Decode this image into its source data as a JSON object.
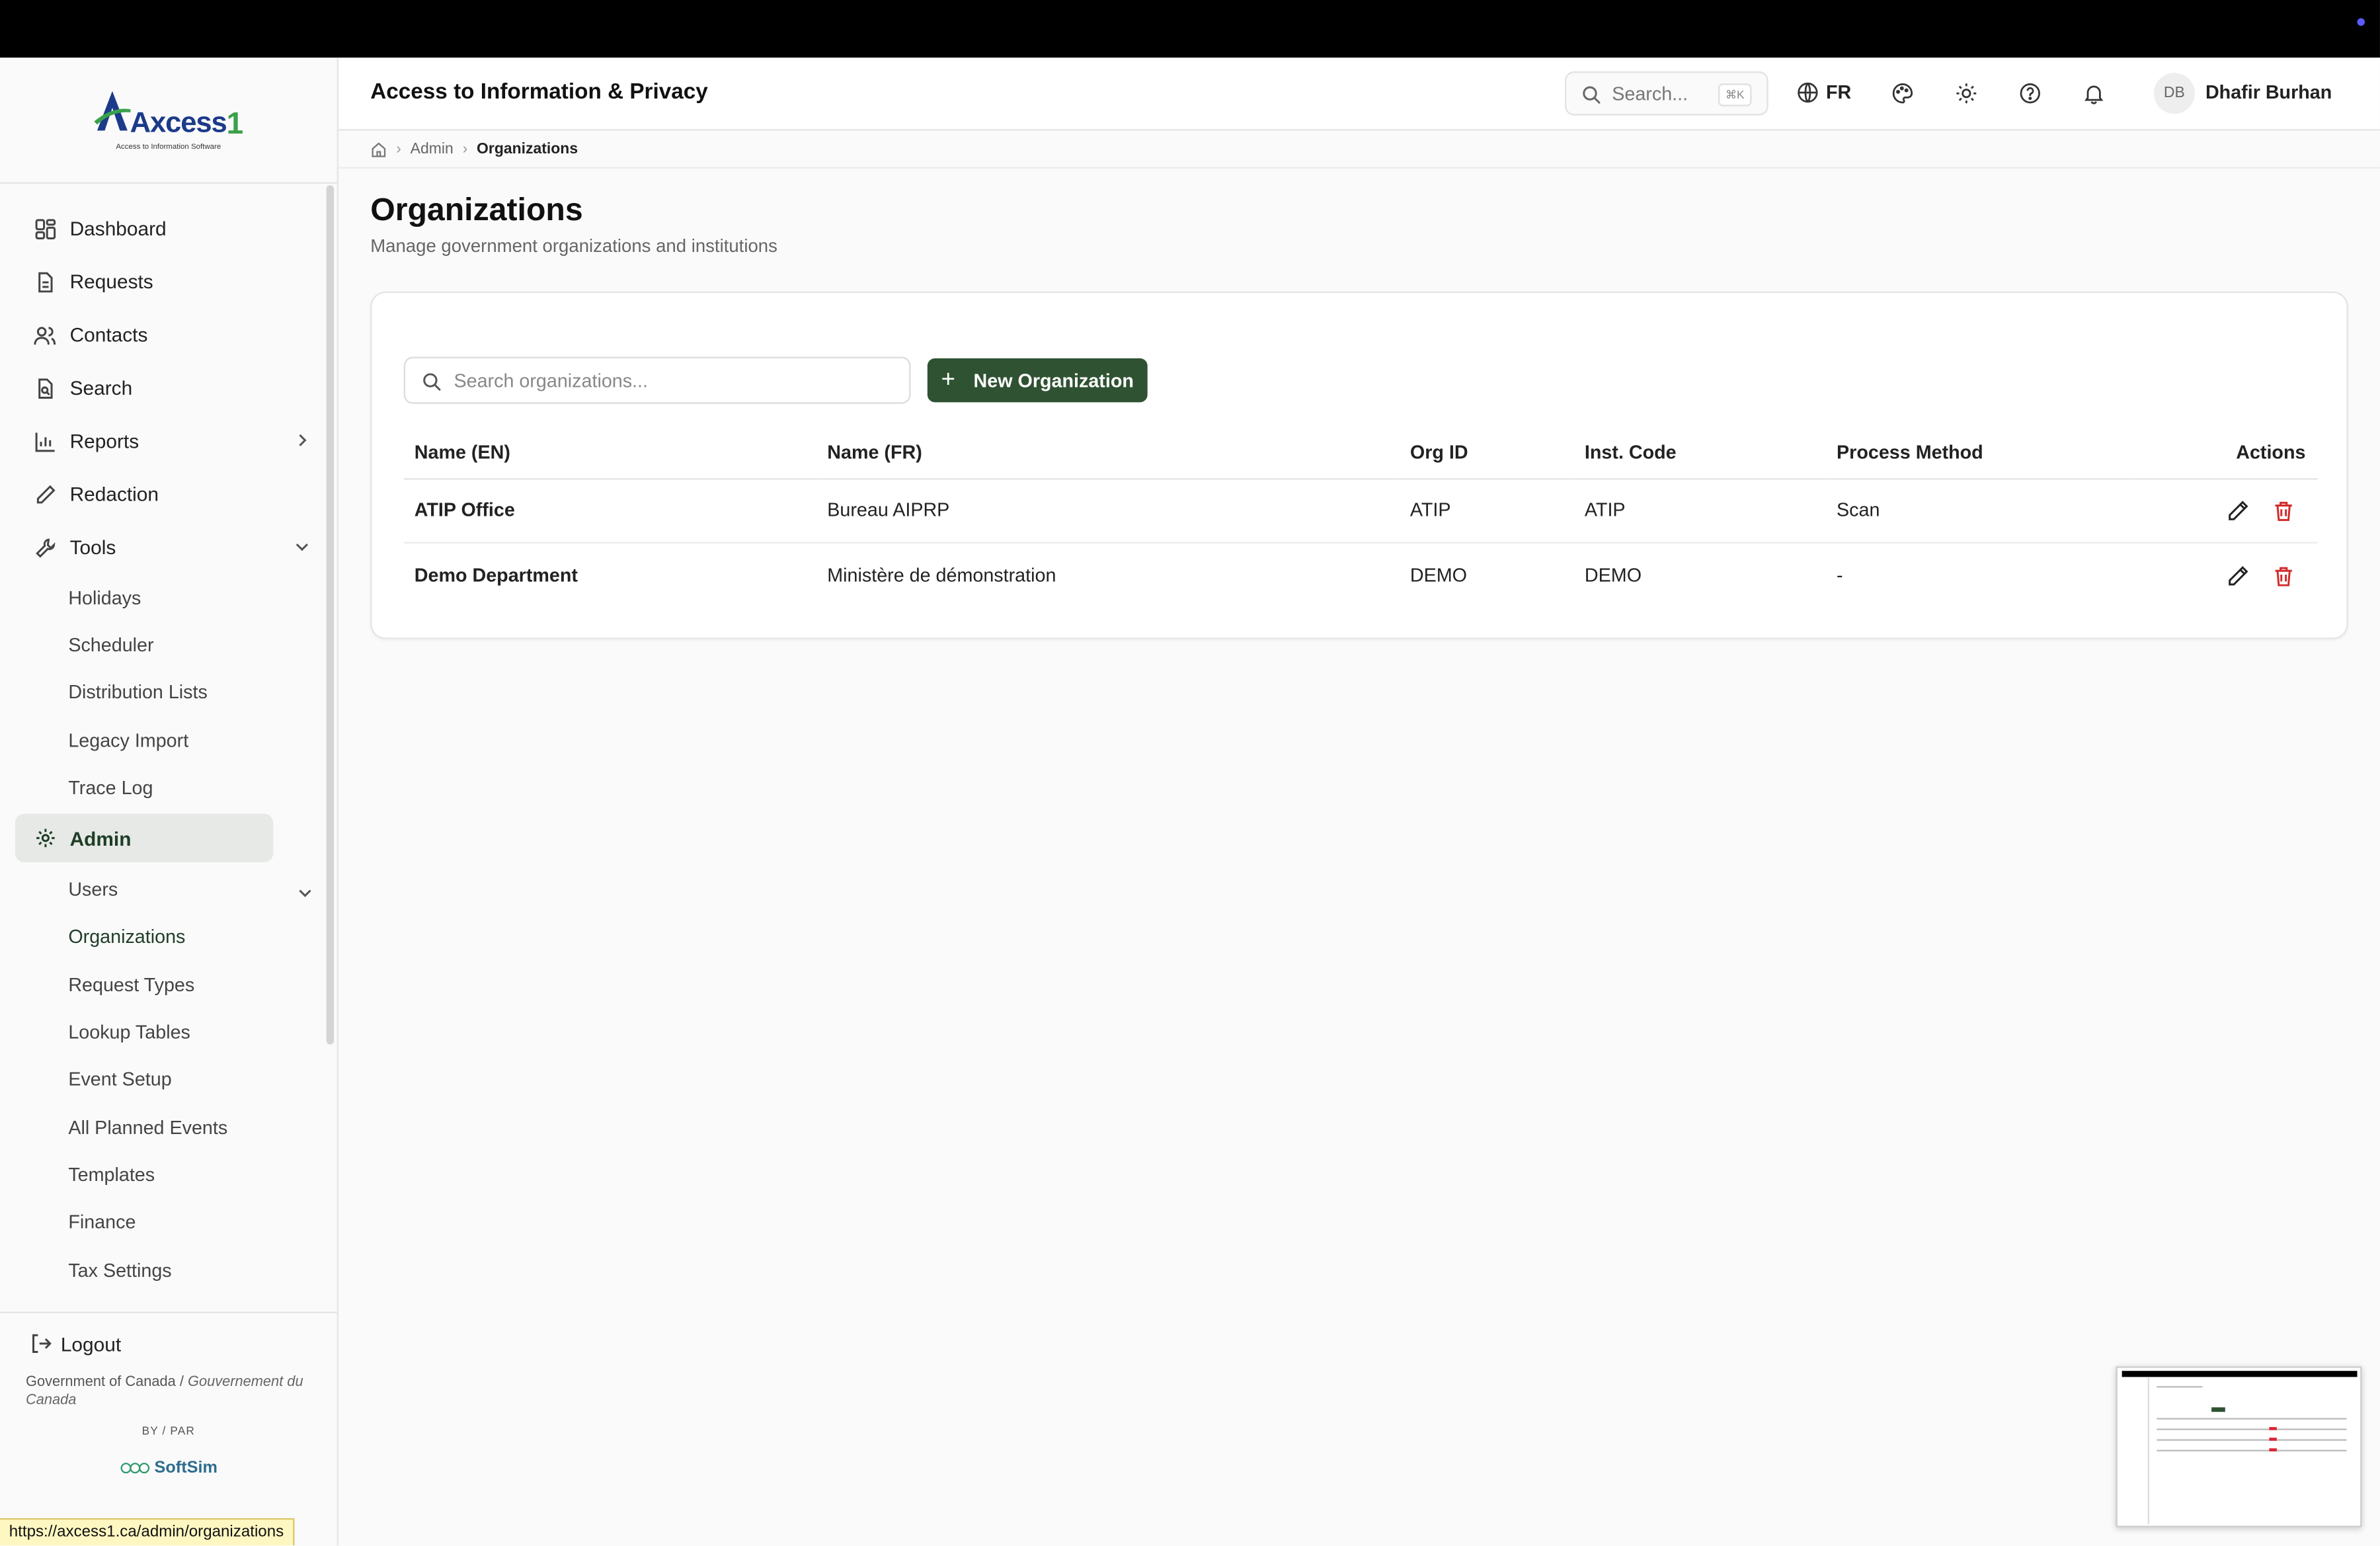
{
  "app": {
    "title": "Access to Information & Privacy",
    "logo_main": "Axcess",
    "logo_num": "1",
    "logo_sub": "Access to Information Software"
  },
  "header": {
    "search_placeholder": "Search...",
    "search_shortcut": "⌘K",
    "language": "FR",
    "user_initials": "DB",
    "user_name": "Dhafir Burhan"
  },
  "sidebar": {
    "items": [
      {
        "label": "Dashboard",
        "icon": "grid-icon"
      },
      {
        "label": "Requests",
        "icon": "document-icon"
      },
      {
        "label": "Contacts",
        "icon": "users-icon"
      },
      {
        "label": "Search",
        "icon": "file-search-icon"
      },
      {
        "label": "Reports",
        "icon": "bar-chart-icon"
      },
      {
        "label": "Redaction",
        "icon": "pen-icon"
      },
      {
        "label": "Tools",
        "icon": "wrench-icon"
      }
    ],
    "tools_sub": [
      "Holidays",
      "Scheduler",
      "Distribution Lists",
      "Legacy Import",
      "Trace Log"
    ],
    "admin": {
      "label": "Admin",
      "icon": "gear-icon"
    },
    "admin_sub": [
      "Users",
      "Organizations",
      "Request Types",
      "Lookup Tables",
      "Event Setup",
      "All Planned Events",
      "Templates",
      "Finance",
      "Tax Settings"
    ],
    "logout": "Logout",
    "gov_en": "Government of Canada",
    "gov_sep": " / ",
    "gov_fr": "Gouvernement du Canada",
    "by": "BY / PAR",
    "vendor": "SoftSim"
  },
  "breadcrumb": {
    "items": [
      "Admin",
      "Organizations"
    ]
  },
  "page": {
    "title": "Organizations",
    "subtitle": "Manage government organizations and institutions"
  },
  "toolbar": {
    "search_placeholder": "Search organizations...",
    "new_label": "New Organization"
  },
  "table": {
    "headers": [
      "Name (EN)",
      "Name (FR)",
      "Org ID",
      "Inst. Code",
      "Process Method",
      "Actions"
    ],
    "rows": [
      [
        "ATIP Office",
        "Bureau AIPRP",
        "ATIP",
        "ATIP",
        "Scan"
      ],
      [
        "Demo Department",
        "Ministère de démonstration",
        "DEMO",
        "DEMO",
        "-"
      ]
    ]
  },
  "status_url": "https://axcess1.ca/admin/organizations",
  "colors": {
    "primary": "#2f5232",
    "danger": "#d22b2b",
    "brand_blue": "#1b3a8a",
    "brand_green": "#3aa14a"
  }
}
